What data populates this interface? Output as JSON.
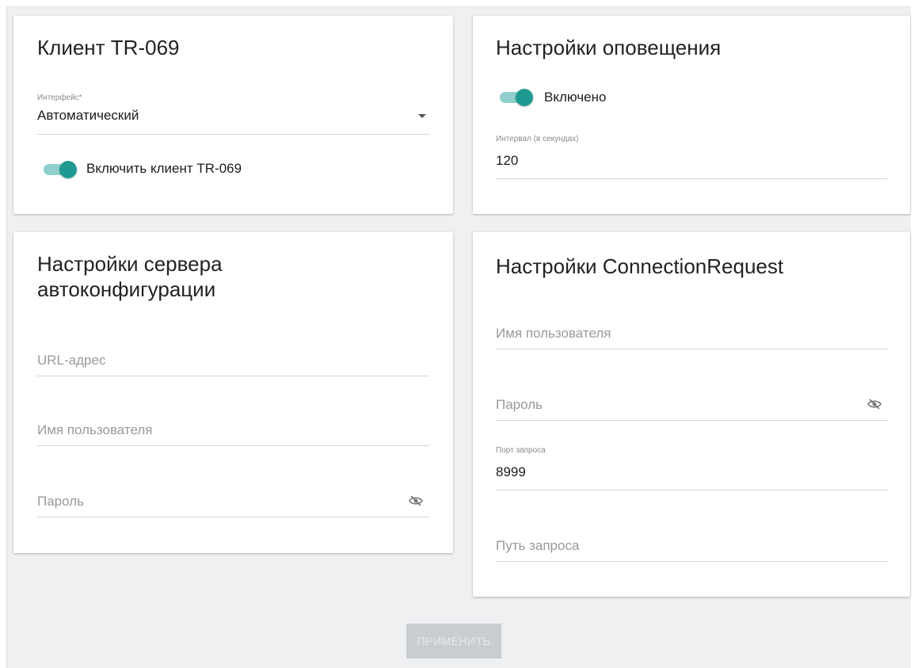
{
  "tr069_client": {
    "title": "Клиент TR-069",
    "interface_label": "Интерфейс*",
    "interface_value": "Автоматический",
    "enable_label": "Включить клиент TR-069",
    "enabled": true
  },
  "notification_settings": {
    "title": "Настройки оповещения",
    "enabled_label": "Включено",
    "enabled": true,
    "interval_label": "Интервал (в секундах)",
    "interval_value": "120"
  },
  "acs_settings": {
    "title_line1": "Настройки сервера",
    "title_line2": "автоконфигурации",
    "url_placeholder": "URL-адрес",
    "username_placeholder": "Имя пользователя",
    "password_placeholder": "Пароль"
  },
  "connection_request": {
    "title": "Настройки ConnectionRequest",
    "username_placeholder": "Имя пользователя",
    "password_placeholder": "Пароль",
    "port_label": "Порт запроса",
    "port_value": "8999",
    "path_placeholder": "Путь запроса"
  },
  "actions": {
    "apply_label": "ПРИМЕНИТЬ"
  },
  "colors": {
    "accent": "#1f9a92",
    "toggle_track": "#8fd0cc",
    "background": "#eef0f2",
    "button_disabled": "#c9cdd1"
  }
}
